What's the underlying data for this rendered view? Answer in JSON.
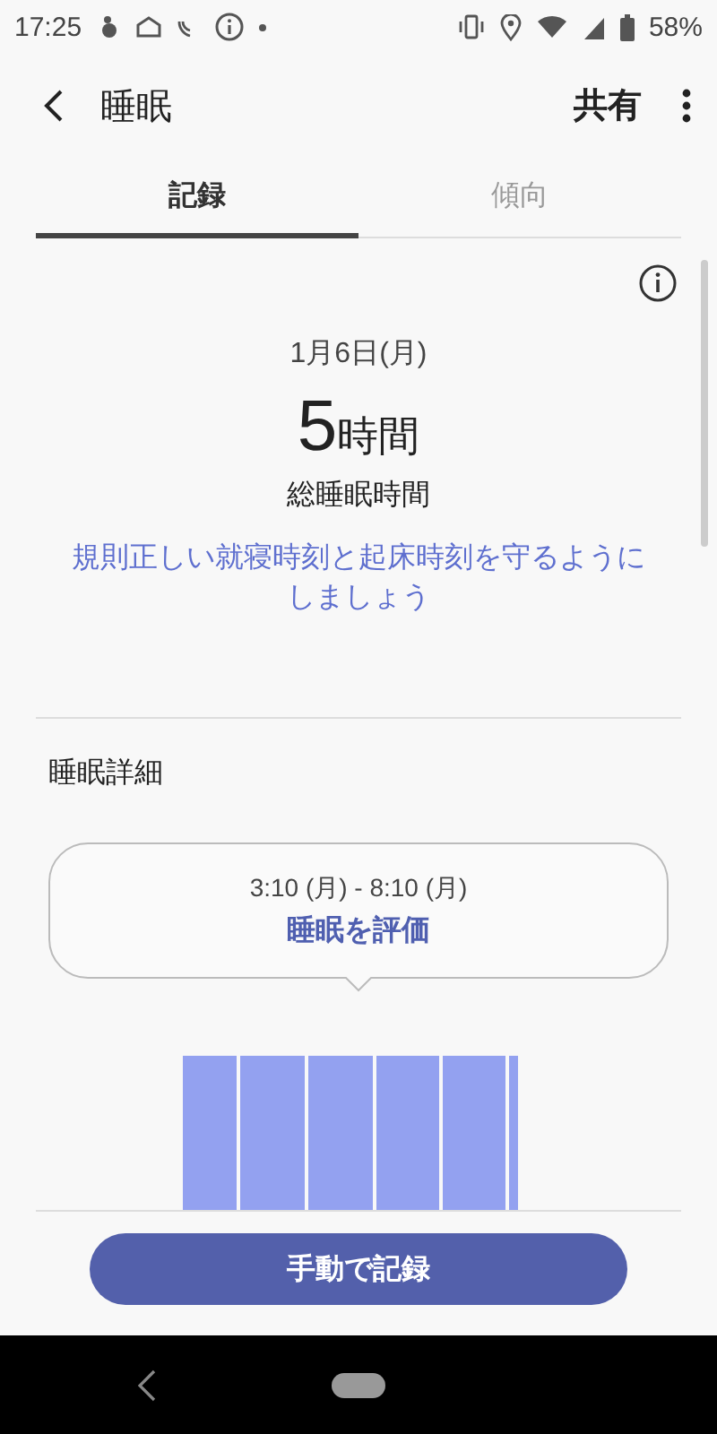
{
  "status_bar": {
    "time": "17:25",
    "battery": "58%"
  },
  "app_bar": {
    "title": "睡眠",
    "share": "共有"
  },
  "tabs": [
    {
      "label": "記録",
      "selected": true
    },
    {
      "label": "傾向",
      "selected": false
    }
  ],
  "summary": {
    "date": "1月6日(月)",
    "duration_value": "5",
    "duration_unit": "時間",
    "duration_label": "総睡眠時間",
    "advice": "規則正しい就寝時刻と起床時刻を守るようにしましょう"
  },
  "details": {
    "heading": "睡眠詳細",
    "bubble": {
      "range": "3:10 (月) - 8:10 (月)",
      "link": "睡眠を評価"
    }
  },
  "button": "手動で記録"
}
